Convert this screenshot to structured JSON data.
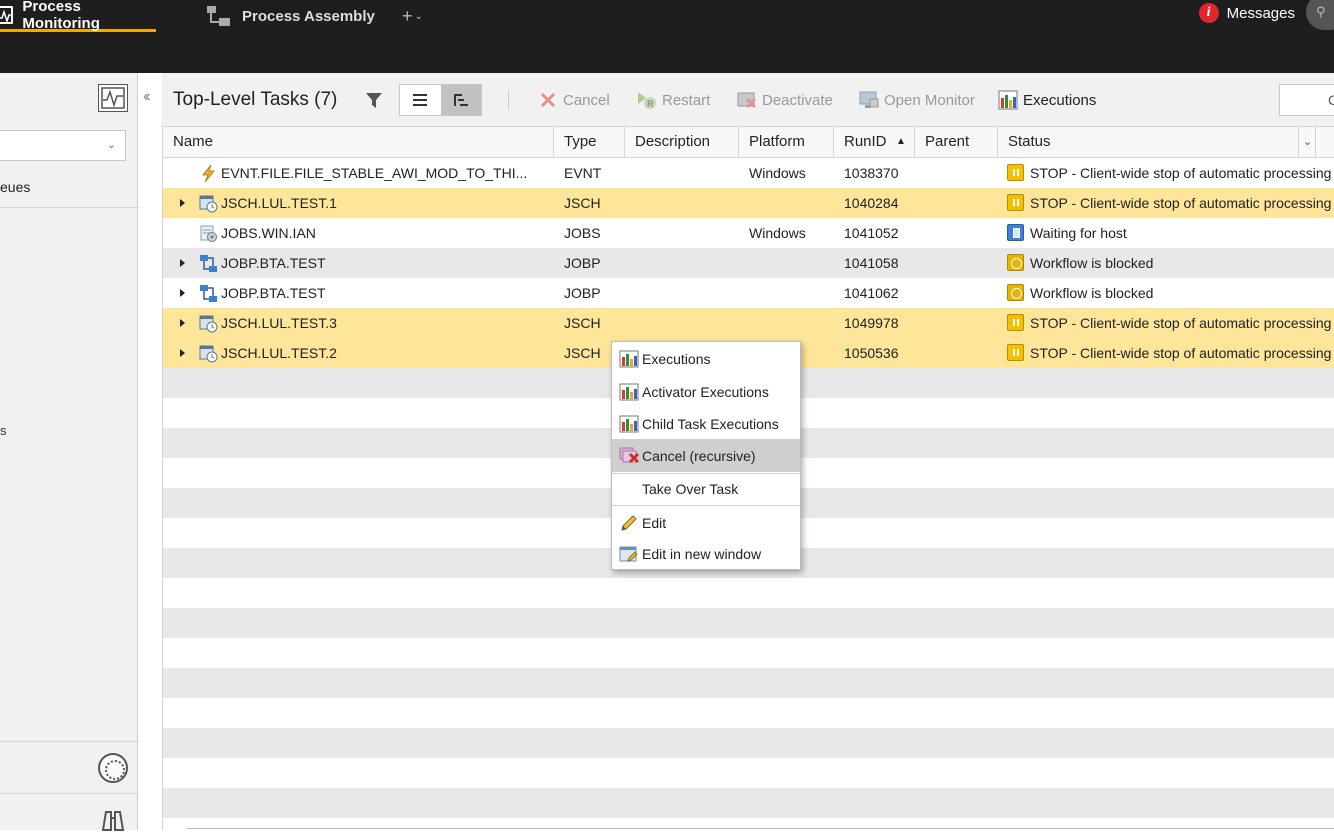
{
  "topbar": {
    "tabs": [
      {
        "label": "Process Monitoring",
        "active": true
      },
      {
        "label": "Process Assembly",
        "active": false
      }
    ],
    "add_tab_label": "+",
    "messages_label": "Messages",
    "messages_icon_glyph": "i",
    "accent_color": "#f5a800"
  },
  "sidebar": {
    "queues_label": "eues",
    "tick_label": "s"
  },
  "toolbar": {
    "title": "Top-Level Tasks (7)",
    "cancel_label": "Cancel",
    "restart_label": "Restart",
    "deactivate_label": "Deactivate",
    "open_monitor_label": "Open Monitor",
    "executions_label": "Executions",
    "right_box_label": "C"
  },
  "grid": {
    "columns": [
      "Name",
      "Type",
      "Description",
      "Platform",
      "RunID",
      "Parent",
      "Status"
    ],
    "sort_indicator": "▲",
    "rows": [
      {
        "name": "EVNT.FILE.FILE_STABLE_AWI_MOD_TO_THI...",
        "type": "EVNT",
        "description": "",
        "platform": "Windows",
        "runid": "1038370",
        "parent": "",
        "status": "STOP - Client-wide stop of automatic processing",
        "expandable": false,
        "highlight": false,
        "icon": "event-lightning-icon",
        "status_icon": "stop-status-icon"
      },
      {
        "name": "JSCH.LUL.TEST.1",
        "type": "JSCH",
        "description": "",
        "platform": "",
        "runid": "1040284",
        "parent": "",
        "status": "STOP - Client-wide stop of automatic processing",
        "expandable": true,
        "highlight": true,
        "icon": "schedule-icon",
        "status_icon": "stop-status-icon"
      },
      {
        "name": "JOBS.WIN.IAN",
        "type": "JOBS",
        "description": "",
        "platform": "Windows",
        "runid": "1041052",
        "parent": "",
        "status": "Waiting for host",
        "expandable": false,
        "highlight": false,
        "icon": "job-icon",
        "status_icon": "waiting-status-icon"
      },
      {
        "name": "JOBP.BTA.TEST",
        "type": "JOBP",
        "description": "",
        "platform": "",
        "runid": "1041058",
        "parent": "",
        "status": "Workflow is blocked",
        "expandable": true,
        "highlight": false,
        "icon": "workflow-icon",
        "status_icon": "blocked-status-icon"
      },
      {
        "name": "JOBP.BTA.TEST",
        "type": "JOBP",
        "description": "",
        "platform": "",
        "runid": "1041062",
        "parent": "",
        "status": "Workflow is blocked",
        "expandable": true,
        "highlight": false,
        "icon": "workflow-icon",
        "status_icon": "blocked-status-icon"
      },
      {
        "name": "JSCH.LUL.TEST.3",
        "type": "JSCH",
        "description": "",
        "platform": "",
        "runid": "1049978",
        "parent": "",
        "status": "STOP - Client-wide stop of automatic processing",
        "expandable": true,
        "highlight": true,
        "icon": "schedule-icon",
        "status_icon": "stop-status-icon"
      },
      {
        "name": "JSCH.LUL.TEST.2",
        "type": "JSCH",
        "description": "",
        "platform": "",
        "runid": "1050536",
        "parent": "",
        "status": "STOP - Client-wide stop of automatic processing",
        "expandable": true,
        "highlight": true,
        "icon": "schedule-icon",
        "status_icon": "stop-status-icon"
      }
    ],
    "highlight_color": "#fde599",
    "alt_row_color": "#e8e8e8"
  },
  "context_menu": {
    "items": [
      {
        "label": "Executions",
        "icon": "executions-chart-icon",
        "active": false
      },
      {
        "label": "Activator Executions",
        "icon": "executions-chart-icon",
        "active": false
      },
      {
        "label": "Child Task Executions",
        "icon": "executions-chart-icon",
        "active": false
      },
      {
        "label": "Cancel (recursive)",
        "icon": "cancel-recursive-icon",
        "active": true
      },
      {
        "label": "Take Over Task",
        "icon": "",
        "active": false
      },
      {
        "label": "Edit",
        "icon": "edit-pencil-icon",
        "active": false
      },
      {
        "label": "Edit in new window",
        "icon": "edit-new-window-icon",
        "active": false
      }
    ]
  }
}
